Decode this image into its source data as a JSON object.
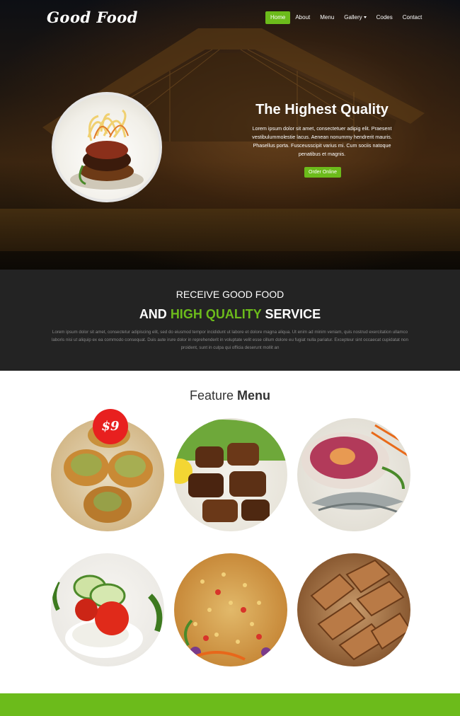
{
  "brand": {
    "logo": "Good Food"
  },
  "nav": {
    "items": [
      {
        "label": "Home",
        "active": true
      },
      {
        "label": "About",
        "active": false
      },
      {
        "label": "Menu",
        "active": false
      },
      {
        "label": "Gallery",
        "active": false,
        "has_dropdown": true
      },
      {
        "label": "Codes",
        "active": false
      },
      {
        "label": "Contact",
        "active": false
      }
    ]
  },
  "hero": {
    "title": "The Highest Quality",
    "text": "Lorem ipsum dolor sit amet, consectetuer adipig elit. Praesent vestibulummolestie lacus. Aenean nonummy hendrerit mauris. Phasellus porta. Fusceusscipit varius mi. Cum sociis natoque penatibus et magnis.",
    "button": "Order Online"
  },
  "intro": {
    "line1": "RECEIVE GOOD FOOD",
    "line2_prefix": "AND ",
    "line2_highlight": "HIGH QUALITY",
    "line2_suffix": " SERVICE",
    "paragraph": "Lorem ipsum dolor sit amet, consectetur adipiscing elit, sed do eiusmod tempor incididunt ut labore et dolore magna aliqua. Ut enim ad minim veniam, quis nostrud exercitation ullamco laboris nisi ut aliquip ex ea commodo consequat. Duis aute irure dolor in reprehenderit in voluptate velit esse cillum dolore eu fugiat nulla pariatur. Excepteur sint occaecat cupidatat non proident, sunt in culpa qui officia deserunt mollit an"
  },
  "feature": {
    "title_light": "Feature ",
    "title_bold": "Menu",
    "price_badge": "$9",
    "dishes": [
      {
        "name": "pastry-icon"
      },
      {
        "name": "grilled-meat-icon"
      },
      {
        "name": "ham-shrimp-icon"
      },
      {
        "name": "salad-icon"
      },
      {
        "name": "fried-rice-icon"
      },
      {
        "name": "roast-duck-icon"
      }
    ]
  },
  "colors": {
    "accent": "#6cbb1b",
    "dark": "#232323",
    "badge": "#e8201f"
  }
}
